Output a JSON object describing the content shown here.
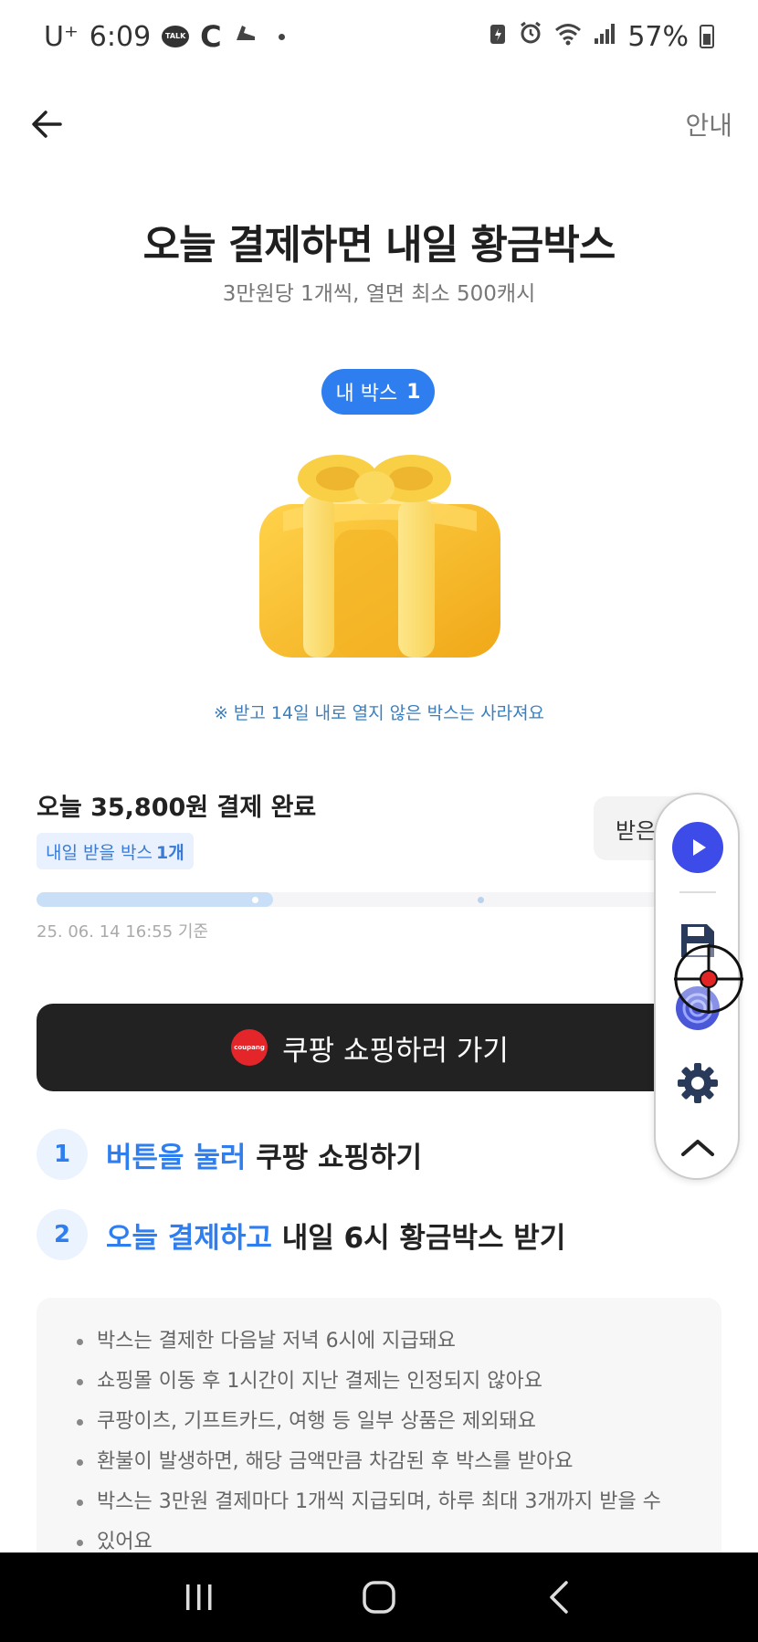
{
  "status_bar": {
    "carrier": "U⁺",
    "time": "6:09",
    "battery": "57%"
  },
  "header": {
    "guide_label": "안내"
  },
  "hero": {
    "title": "오늘 결제하면 내일 황금박스",
    "subtitle": "3만원당 1개씩, 열면 최소 500캐시",
    "my_box_label": "내 박스",
    "my_box_count": "1",
    "notice": "※ 받고 14일 내로 열지 않은 박스는 사라져요"
  },
  "payment": {
    "status": "오늘 35,800원 결제 완료",
    "tomorrow_label": "내일 받을 박스",
    "tomorrow_count": "1개",
    "receive_label": "받은",
    "progress_fraction": 0.355,
    "timestamp": "25. 06. 14 16:55 기준"
  },
  "shop_button": {
    "label": "쿠팡 쇼핑하러 가기",
    "logo_text": "coupang"
  },
  "steps": [
    {
      "num": "1",
      "highlight": "버튼을 눌러",
      "rest": " 쿠팡 쇼핑하기"
    },
    {
      "num": "2",
      "highlight": "오늘 결제하고",
      "rest": " 내일 6시 황금박스 받기"
    }
  ],
  "info_items": [
    "박스는 결제한 다음날 저녁 6시에 지급돼요",
    "쇼핑몰 이동 후 1시간이 지난 결제는 인정되지 않아요",
    "쿠팡이츠, 기프트카드, 여행 등 일부 상품은 제외돼요",
    "환불이 발생하면, 해당 금액만큼 차감된 후 박스를 받아요",
    "박스는 3만원 결제마다 1개씩 지급되며, 하루 최대 3개까지 받을 수",
    "있어요"
  ],
  "colors": {
    "accent": "#2f7ef0",
    "button_dark": "#222222",
    "coupang_red": "#e4262b",
    "gold": "#f7b928"
  },
  "icons": {
    "back": "arrow-left-icon",
    "gift": "gift-box-icon",
    "play": "play-icon",
    "save": "floppy-disk-icon",
    "gear": "gear-icon",
    "up": "chevron-up-icon"
  }
}
